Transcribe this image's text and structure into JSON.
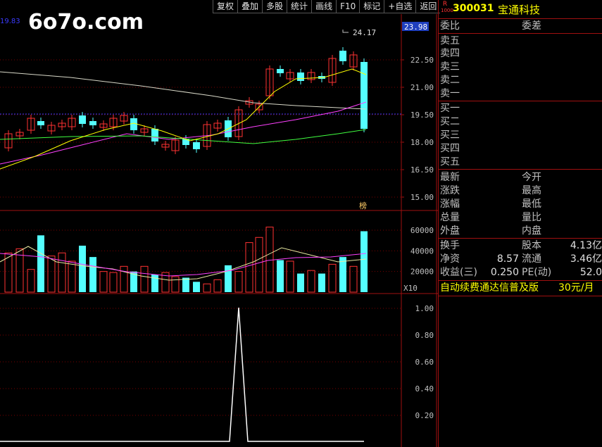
{
  "watermark": "6o7o.com",
  "toolbar": [
    "复权",
    "叠加",
    "多股",
    "统计",
    "画线",
    "F10",
    "标记",
    "+自选",
    "返回"
  ],
  "left_price_label": "19.83",
  "stock": {
    "badge_top": "R",
    "badge_bottom": "1000",
    "code": "300031",
    "name": "宝通科技"
  },
  "price_chart": {
    "current_price_box": "23.98",
    "high_label": "24.17",
    "rank_badge": "榜",
    "y_ticks": [
      "22.50",
      "21.00",
      "19.50",
      "18.00",
      "16.50",
      "15.00"
    ]
  },
  "volume_chart": {
    "y_ticks": [
      "60000",
      "40000",
      "20000"
    ],
    "unit": "X10"
  },
  "indicator_chart": {
    "y_ticks": [
      "1.00",
      "0.80",
      "0.60",
      "0.40",
      "0.20"
    ]
  },
  "order_book": {
    "header_left": "委比",
    "header_right": "委差",
    "asks": [
      "卖五",
      "卖四",
      "卖三",
      "卖二",
      "卖一"
    ],
    "bids": [
      "买一",
      "买二",
      "买三",
      "买四",
      "买五"
    ]
  },
  "quote": {
    "rows": [
      {
        "left": "最新",
        "right": "今开"
      },
      {
        "left": "涨跌",
        "right": "最高"
      },
      {
        "left": "涨幅",
        "right": "最低"
      },
      {
        "left": "总量",
        "right": "量比"
      },
      {
        "left": "外盘",
        "right": "内盘"
      }
    ]
  },
  "fundamentals": {
    "turnover_label": "换手",
    "total_shares_label": "股本",
    "total_shares_value": "4.13亿",
    "nav_label": "净资",
    "nav_value": "8.57",
    "float_label": "流通",
    "float_value": "3.46亿",
    "eps_label": "收益(三)",
    "eps_value": "0.250",
    "pe_label": "PE(动)",
    "pe_value": "52.0"
  },
  "ad": {
    "text": "自动续费通达信普及版",
    "price": "30元/月"
  },
  "colors": {
    "up": "#ff3232",
    "down": "#54ffff",
    "axis": "#a01010",
    "grid": "#7a0000",
    "yellow": "#ffff00"
  }
}
